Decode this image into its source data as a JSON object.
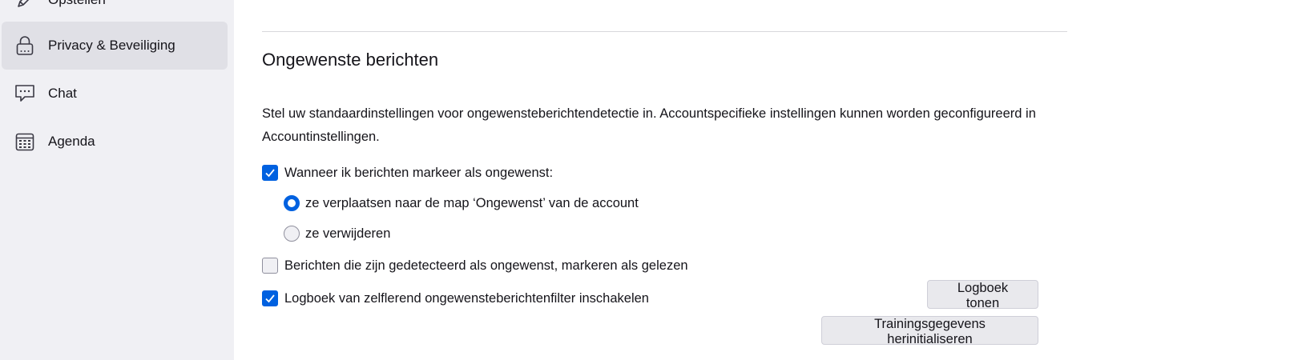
{
  "sidebar": {
    "items": [
      {
        "label": "Opstellen",
        "icon": "pen-icon",
        "selected": false
      },
      {
        "label": "Privacy & Beveiliging",
        "icon": "lock-icon",
        "selected": true
      },
      {
        "label": "Chat",
        "icon": "chat-bubble-icon",
        "selected": false
      },
      {
        "label": "Agenda",
        "icon": "calendar-icon",
        "selected": false
      }
    ]
  },
  "junk": {
    "title": "Ongewenste berichten",
    "description": "Stel uw standaardinstellingen voor ongewensteberichtendetectie in. Accountspecifieke instellingen kunnen worden geconfigureerd in Accountinstellingen.",
    "mark_option": {
      "label": "Wanneer ik berichten markeer als ongewenst:",
      "checked": true
    },
    "move_option": {
      "label": "ze verplaatsen naar de map ‘Ongewenst’ van de account",
      "selected": true
    },
    "delete_option": {
      "label": "ze verwijderen",
      "selected": false
    },
    "mark_read_option": {
      "label": "Berichten die zijn gedetecteerd als ongewenst, markeren als gelezen",
      "checked": false
    },
    "logging_option": {
      "label": "Logboek van zelflerend ongewensteberichtenfilter inschakelen",
      "checked": true
    },
    "show_log_button": "Logboek tonen",
    "reset_training_button": "Trainingsgegevens herinitialiseren"
  },
  "colors": {
    "accent": "#0061e0",
    "sidebar_bg": "#f0f0f4",
    "selected_bg": "#e0e0e6"
  }
}
